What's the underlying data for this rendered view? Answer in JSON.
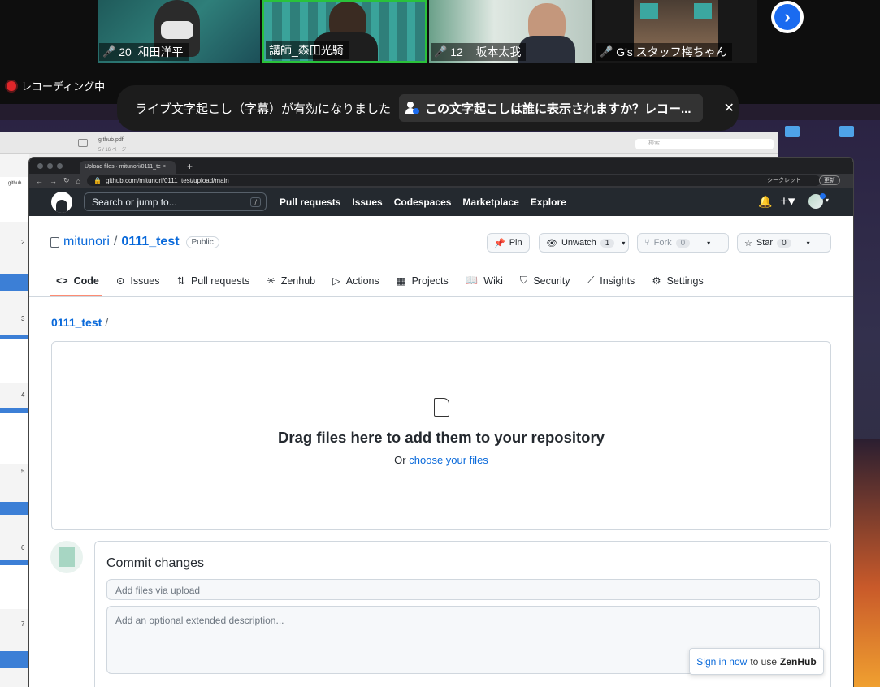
{
  "meeting": {
    "participants": [
      {
        "name": "20_和田洋平"
      },
      {
        "name": "講師_森田光騎"
      },
      {
        "name": "12__坂本太我"
      },
      {
        "name": "G's スタッフ梅ちゃん"
      }
    ],
    "recording_label": "レコーディング中",
    "caption_notice": "ライブ文字起こし（字幕）が有効になりました",
    "caption_question": "この文字起こしは誰に表示されますか？レコー...",
    "close_glyph": "✕"
  },
  "preview": {
    "doc_title": "github.pdf",
    "page_info": "5 / 16 ページ",
    "search_placeholder": "検索",
    "page_numbers": [
      "2",
      "3",
      "4",
      "5",
      "6",
      "7"
    ]
  },
  "browser": {
    "tab_title": "Upload files · mitunori/0111_te",
    "url": "github.com/mitunori/0111_test/upload/main",
    "incognito": "シークレット",
    "update": "更新"
  },
  "gh_header": {
    "search": "Search or jump to...",
    "search_key": "/",
    "nav": [
      "Pull requests",
      "Issues",
      "Codespaces",
      "Marketplace",
      "Explore"
    ]
  },
  "repo": {
    "owner": "mitunori",
    "sep": "/",
    "name": "0111_test",
    "visibility": "Public",
    "pin": "Pin",
    "unwatch": "Unwatch",
    "unwatch_count": "1",
    "fork": "Fork",
    "fork_count": "0",
    "star": "Star",
    "star_count": "0",
    "tabs": [
      "Code",
      "Issues",
      "Pull requests",
      "Zenhub",
      "Actions",
      "Projects",
      "Wiki",
      "Security",
      "Insights",
      "Settings"
    ],
    "breadcrumb": "0111_test",
    "breadcrumb_sep": "/"
  },
  "upload": {
    "title": "Drag files here to add them to your repository",
    "or": "Or",
    "choose": "choose your files"
  },
  "commit": {
    "heading": "Commit changes",
    "summary_placeholder": "Add files via upload",
    "desc_placeholder": "Add an optional extended description..."
  },
  "zenhub": {
    "signin": "Sign in now",
    "rest": "to use",
    "brand": "ZenHub"
  },
  "colors": {
    "recording": "#e0262a",
    "gh_header": "#24292f",
    "link": "#0969da",
    "zoom_blue": "#1a6bf0"
  }
}
